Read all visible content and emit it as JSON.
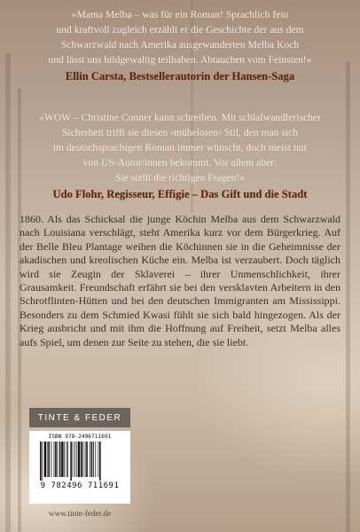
{
  "quotes": [
    {
      "lines": [
        "»Mama Melba – was für ein Roman! Sprachlich fein",
        "und kraftvoll zugleich erzählt er die Geschichte der aus dem",
        "Schwarzwald nach Amerika ausgewanderten Melba Koch",
        "und lässt uns bildgewaltig teilhaben. Abtauchen vom Feinsten!«"
      ],
      "author": "Ellin Carsta, Bestsellerautorin der Hansen-Saga"
    },
    {
      "lines": [
        "»WOW – Christine Conner kann schreiben. Mit schlafwandlerischer",
        "Sicherheit trifft sie diesen ›mühelosen‹ Stil, den man sich",
        "im deutschsprachigen Roman immer wünscht, doch meist nur",
        "von US-Autor/innen bekommt. Vor allem aber:",
        "Sie stellt die richtigen Fragen!«"
      ],
      "author": "Udo Flohr, Regisseur, Effigie – Das Gift und die Stadt"
    }
  ],
  "blurb": "1860. Als das Schicksal die junge Köchin Melba aus dem Schwarzwald nach Louisiana verschlägt, steht Amerika kurz vor dem Bürgerkrieg. Auf der Belle Bleu Plantage weihen die Köchinnen sie in die Geheimnisse der akadischen und kreolischen Küche ein. Melba ist verzaubert. Doch täglich wird sie Zeugin der Sklaverei – ihrer Unmenschlichkeit, ihrer Grausamkeit. Freundschaft erfährt sie bei den versklavten Arbeitern in den Schrotflinten-Hütten und bei den deutschen Immigranten am Mississippi. Besonders zu dem Schmied Kwasi fühlt sie sich bald hingezogen. Als der Krieg ausbricht und mit ihm die Hoffnung auf Freiheit, setzt Melba alles aufs Spiel, um denen zur Seite zu stehen, die sie liebt.",
  "publisher": "TINTE & FEDER",
  "isbn_label": "ISBN 978-2496711691",
  "ean_digits": "9 782496 711691",
  "website": "www.tinte-feder.de",
  "colors": {
    "author_text": "#5a2410",
    "quote_text": "#f6efe6",
    "body_text": "#3a2e26",
    "publisher_bg": "#6b635d"
  }
}
